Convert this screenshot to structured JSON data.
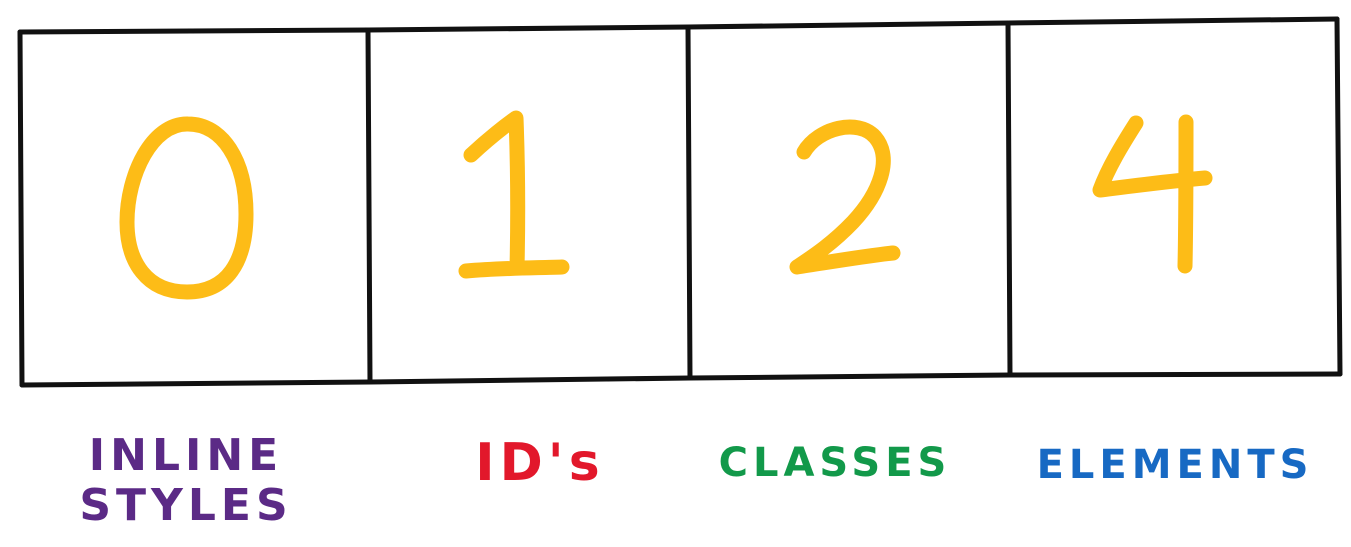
{
  "diagram": {
    "boxes": [
      {
        "value": "0",
        "label_lines": [
          "INLINE",
          "STYLES"
        ],
        "label_color": "#5B2A86"
      },
      {
        "value": "1",
        "label_lines": [
          "ID's"
        ],
        "label_color": "#E2182B"
      },
      {
        "value": "2",
        "label_lines": [
          "CLASSES"
        ],
        "label_color": "#12994A"
      },
      {
        "value": "4",
        "label_lines": [
          "ELEMENTS"
        ],
        "label_color": "#1769C3"
      }
    ],
    "digit_color": "#FDBC17",
    "line_color": "#111111"
  }
}
